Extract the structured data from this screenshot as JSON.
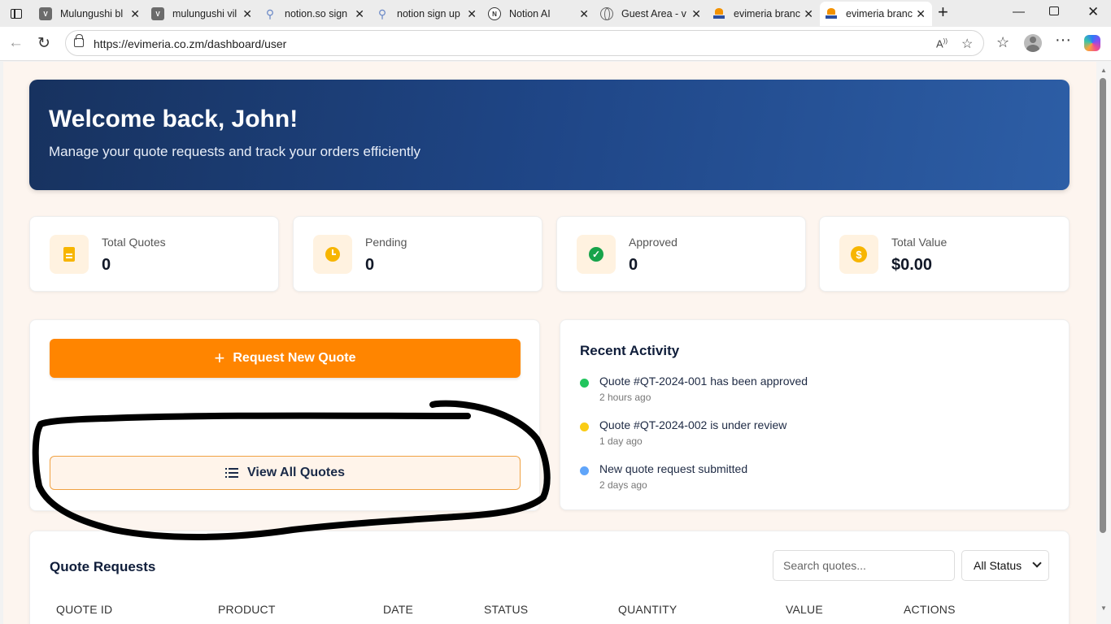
{
  "browser": {
    "tabs": [
      {
        "title": "Mulungushi bl",
        "icon": "v-logo-icon"
      },
      {
        "title": "mulungushi vil",
        "icon": "v-logo-icon"
      },
      {
        "title": "notion.so sign",
        "icon": "search-icon"
      },
      {
        "title": "notion sign up",
        "icon": "search-icon"
      },
      {
        "title": "Notion AI",
        "icon": "notion-icon"
      },
      {
        "title": "Guest Area - v",
        "icon": "globe-icon"
      },
      {
        "title": "evimeria branc",
        "icon": "evimeria-logo-icon"
      },
      {
        "title": "evimeria branc",
        "icon": "evimeria-logo-icon"
      }
    ],
    "active_tab_index": 7,
    "url": "https://evimeria.co.zm/dashboard/user"
  },
  "hero": {
    "title": "Welcome back, John!",
    "subtitle": "Manage your quote requests and track your orders efficiently"
  },
  "stats": [
    {
      "label": "Total Quotes",
      "value": "0",
      "icon": "document-icon"
    },
    {
      "label": "Pending",
      "value": "0",
      "icon": "clock-icon"
    },
    {
      "label": "Approved",
      "value": "0",
      "icon": "check-circle-icon"
    },
    {
      "label": "Total Value",
      "value": "$0.00",
      "icon": "dollar-icon"
    }
  ],
  "actions": {
    "request_label": "Request New Quote",
    "view_label": "View All Quotes"
  },
  "activity": {
    "title": "Recent Activity",
    "items": [
      {
        "text": "Quote #QT-2024-001 has been approved",
        "time": "2 hours ago",
        "color": "#22c55e"
      },
      {
        "text": "Quote #QT-2024-002 is under review",
        "time": "1 day ago",
        "color": "#facc15"
      },
      {
        "text": "New quote request submitted",
        "time": "2 days ago",
        "color": "#60a5fa"
      }
    ]
  },
  "quotes": {
    "title": "Quote Requests",
    "search_placeholder": "Search quotes...",
    "status_filter": "All Status",
    "columns": [
      "QUOTE ID",
      "PRODUCT",
      "DATE",
      "STATUS",
      "QUANTITY",
      "VALUE",
      "ACTIONS"
    ]
  },
  "colors": {
    "accent": "#ff8500",
    "hero_start": "#17325f",
    "hero_end": "#2d5ea6",
    "page_bg": "#fdf5ef"
  }
}
